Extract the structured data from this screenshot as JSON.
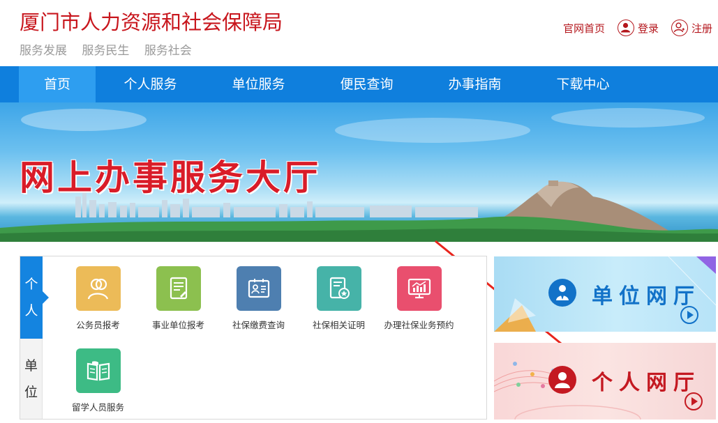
{
  "header": {
    "site_title": "厦门市人力资源和社会保障局",
    "slogans": [
      "服务发展",
      "服务民生",
      "服务社会"
    ],
    "links": {
      "home": "官网首页",
      "login": "登录",
      "register": "注册"
    }
  },
  "nav": {
    "items": [
      "首页",
      "个人服务",
      "单位服务",
      "便民查询",
      "办事指南",
      "下载中心"
    ],
    "active_index": 0
  },
  "banner": {
    "title": "网上办事服务大厅"
  },
  "service_panel": {
    "tab_personal": [
      "个",
      "人"
    ],
    "tab_unit": [
      "单",
      "位"
    ],
    "services": [
      {
        "label": "公务员报考",
        "icon": "person-outline-icon",
        "color": "#ecbb58"
      },
      {
        "label": "事业单位报考",
        "icon": "document-edit-icon",
        "color": "#8cc04f"
      },
      {
        "label": "社保缴费查询",
        "icon": "id-card-icon",
        "color": "#4e7fb0"
      },
      {
        "label": "社保相关证明",
        "icon": "certificate-icon",
        "color": "#46b3a8"
      },
      {
        "label": "办理社保业务预约",
        "icon": "monitor-chart-icon",
        "color": "#e94f6e"
      },
      {
        "label": "留学人员服务",
        "icon": "open-book-icon",
        "color": "#3dbb85"
      }
    ]
  },
  "cards": {
    "unit": {
      "title": "单位网厅"
    },
    "personal": {
      "title": "个人网厅"
    }
  },
  "colors": {
    "brand_red": "#c8161d",
    "nav_blue": "#0f7fdd",
    "annotation_arrow": "#e8241c"
  }
}
